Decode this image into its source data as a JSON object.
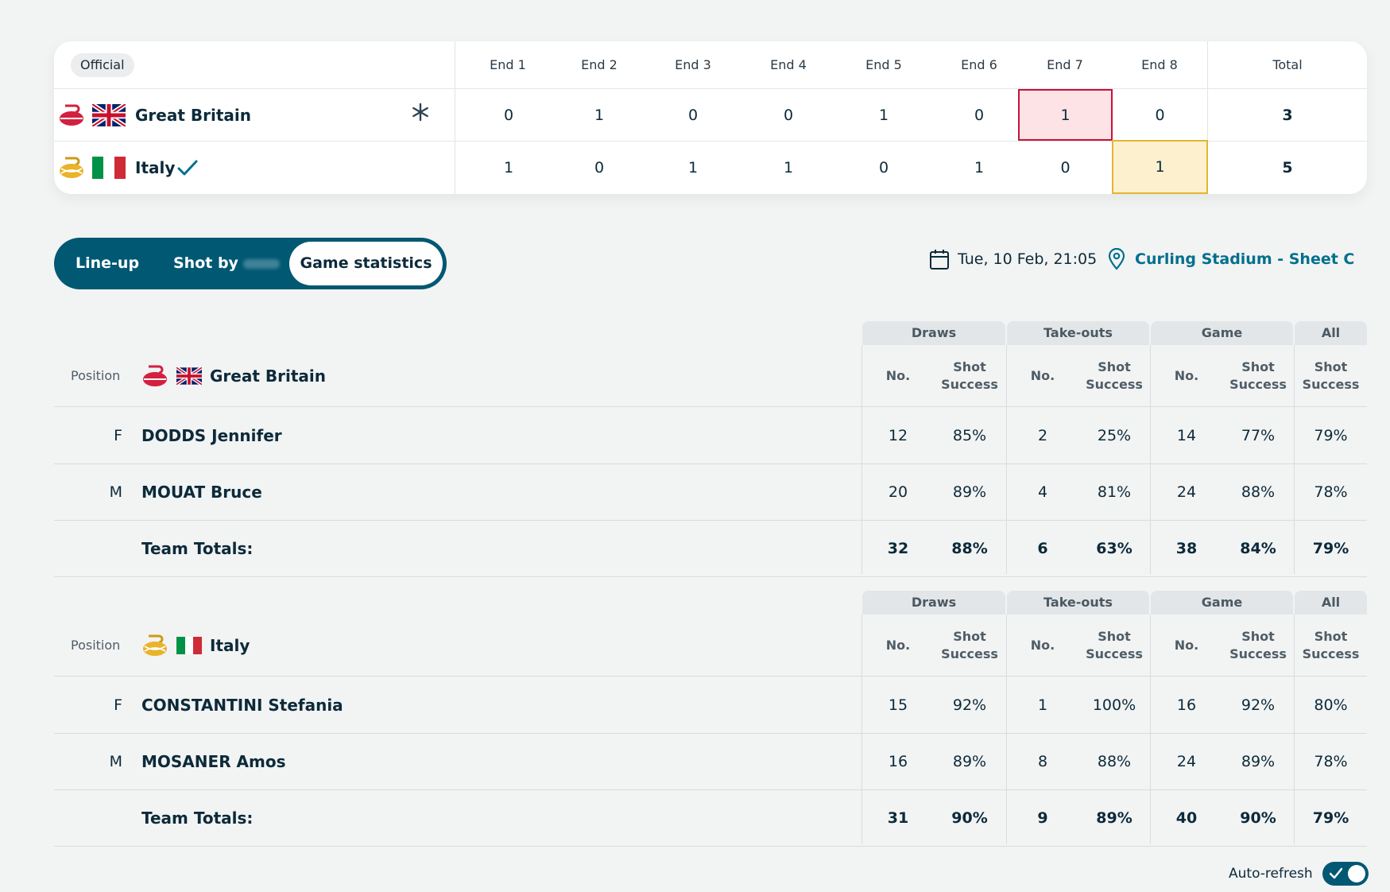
{
  "scoreboard": {
    "status_badge": "Official",
    "ends": [
      "End 1",
      "End 2",
      "End 3",
      "End 4",
      "End 5",
      "End 6",
      "End 7",
      "End 8"
    ],
    "total_label": "Total",
    "teams": [
      {
        "name": "Great Britain",
        "stone_color": "#d3203e",
        "scores": [
          "0",
          "1",
          "0",
          "0",
          "1",
          "0",
          "1",
          "0"
        ],
        "total": "3",
        "marker": "hammer",
        "highlight_end": 7,
        "highlight_color": "#c8123b"
      },
      {
        "name": "Italy",
        "stone_color": "#cf9a14",
        "scores": [
          "1",
          "0",
          "1",
          "1",
          "0",
          "1",
          "0",
          "1"
        ],
        "total": "5",
        "marker": "winner-check",
        "highlight_end": 8,
        "highlight_color": "#e2b534"
      }
    ]
  },
  "tabs": [
    {
      "label": "Line-up",
      "active": false
    },
    {
      "label": "Shot by",
      "active": false
    },
    {
      "label": "Game statistics",
      "active": true
    }
  ],
  "game_info": {
    "datetime": "Tue, 10 Feb, 21:05",
    "venue": "Curling Stadium - Sheet C"
  },
  "stats_header": {
    "groups": [
      "Draws",
      "Take-outs",
      "Game",
      "All"
    ],
    "position_label": "Position",
    "no_label": "No.",
    "shot_label_1": "Shot",
    "shot_label_2": "Success"
  },
  "stats": [
    {
      "team": "Great Britain",
      "rows": [
        {
          "position": "F",
          "player": "DODDS Jennifer",
          "values": [
            "12",
            "85%",
            "2",
            "25%",
            "14",
            "77%",
            "79%"
          ]
        },
        {
          "position": "M",
          "player": "MOUAT Bruce",
          "values": [
            "20",
            "89%",
            "4",
            "81%",
            "24",
            "88%",
            "78%"
          ]
        }
      ],
      "totals_label": "Team Totals:",
      "totals": [
        "32",
        "88%",
        "6",
        "63%",
        "38",
        "84%",
        "79%"
      ]
    },
    {
      "team": "Italy",
      "rows": [
        {
          "position": "F",
          "player": "CONSTANTINI Stefania",
          "values": [
            "15",
            "92%",
            "1",
            "100%",
            "16",
            "92%",
            "80%"
          ]
        },
        {
          "position": "M",
          "player": "MOSANER Amos",
          "values": [
            "16",
            "89%",
            "8",
            "88%",
            "24",
            "89%",
            "78%"
          ]
        }
      ],
      "totals_label": "Team Totals:",
      "totals": [
        "31",
        "90%",
        "9",
        "89%",
        "40",
        "90%",
        "79%"
      ]
    }
  ],
  "auto_refresh": {
    "label": "Auto-refresh",
    "enabled": true
  },
  "colors": {
    "accent": "#005873",
    "link": "#00708e",
    "text": "#0c2a3a",
    "red_highlight": "#c8123b",
    "yellow_highlight": "#e2b534"
  }
}
